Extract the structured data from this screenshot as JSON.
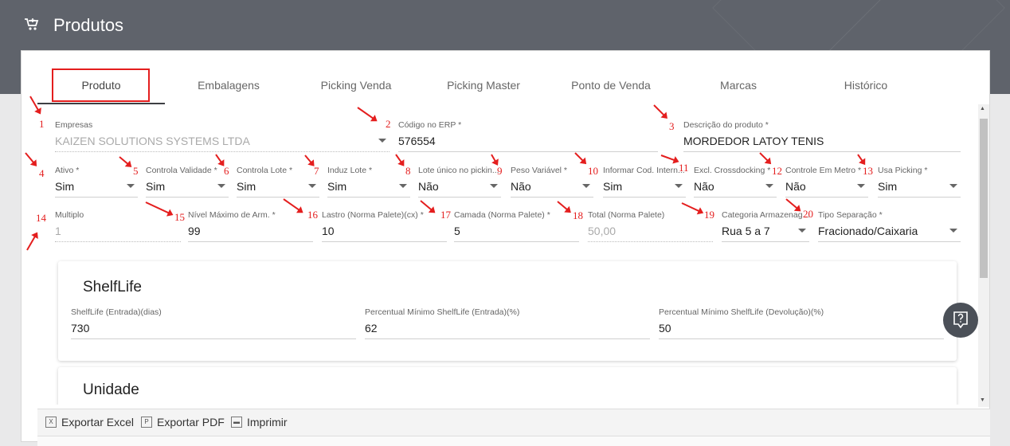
{
  "header": {
    "title": "Produtos"
  },
  "tabs": [
    "Produto",
    "Embalagens",
    "Picking Venda",
    "Picking Master",
    "Ponto de Venda",
    "Marcas",
    "Histórico"
  ],
  "fields": {
    "empresas": {
      "label": "Empresas",
      "value": "KAIZEN SOLUTIONS SYSTEMS LTDA"
    },
    "codigo_erp": {
      "label": "Código no ERP *",
      "value": "576554"
    },
    "descricao": {
      "label": "Descrição do produto *",
      "value": "MORDEDOR LATOY TENIS"
    },
    "ativo": {
      "label": "Ativo *",
      "value": "Sim"
    },
    "controla_validade": {
      "label": "Controla Validade *",
      "value": "Sim"
    },
    "controla_lote": {
      "label": "Controla Lote *",
      "value": "Sim"
    },
    "induz_lote": {
      "label": "Induz Lote *",
      "value": "Sim"
    },
    "lote_unico": {
      "label": "Lote único no pickin...",
      "value": "Não"
    },
    "peso_variavel": {
      "label": "Peso Variável *",
      "value": "Não"
    },
    "informar_cod": {
      "label": "Informar Cod. Intern...",
      "value": "Sim"
    },
    "excl_crossdocking": {
      "label": "Excl. Crossdocking *",
      "value": "Não"
    },
    "controle_metro": {
      "label": "Controle Em Metro *",
      "value": "Não"
    },
    "usa_picking": {
      "label": "Usa Picking *",
      "value": "Sim"
    },
    "multiplo": {
      "label": "Multiplo",
      "value": "1"
    },
    "nivel_max": {
      "label": "Nível Máximo de Arm. *",
      "value": "99"
    },
    "lastro": {
      "label": "Lastro (Norma Palete)(cx) *",
      "value": "10"
    },
    "camada": {
      "label": "Camada (Norma Palete) *",
      "value": "5"
    },
    "total": {
      "label": "Total (Norma Palete)",
      "value": "50,00"
    },
    "categoria": {
      "label": "Categoria Armazenag...",
      "value": "Rua 5 a 7"
    },
    "tipo_separacao": {
      "label": "Tipo Separação *",
      "value": "Fracionado/Caixaria"
    }
  },
  "shelflife": {
    "title": "ShelfLife",
    "entrada": {
      "label": "ShelfLife (Entrada)(dias)",
      "value": "730"
    },
    "min_entrada": {
      "label": "Percentual Mínimo ShelfLife (Entrada)(%)",
      "value": "62"
    },
    "min_devolucao": {
      "label": "Percentual Mínimo ShelfLife (Devolução)(%)",
      "value": "50"
    }
  },
  "unidade": {
    "title": "Unidade"
  },
  "annotations": [
    "1",
    "2",
    "3",
    "4",
    "5",
    "6",
    "7",
    "8",
    "9",
    "10",
    "11",
    "12",
    "13",
    "14",
    "15",
    "16",
    "17",
    "18",
    "19",
    "20"
  ],
  "footer": {
    "excel": "Exportar Excel",
    "pdf": "Exportar PDF",
    "print": "Imprimir"
  },
  "colors": {
    "header_bg": "#5f636b",
    "annotation": "#e41e1e"
  }
}
